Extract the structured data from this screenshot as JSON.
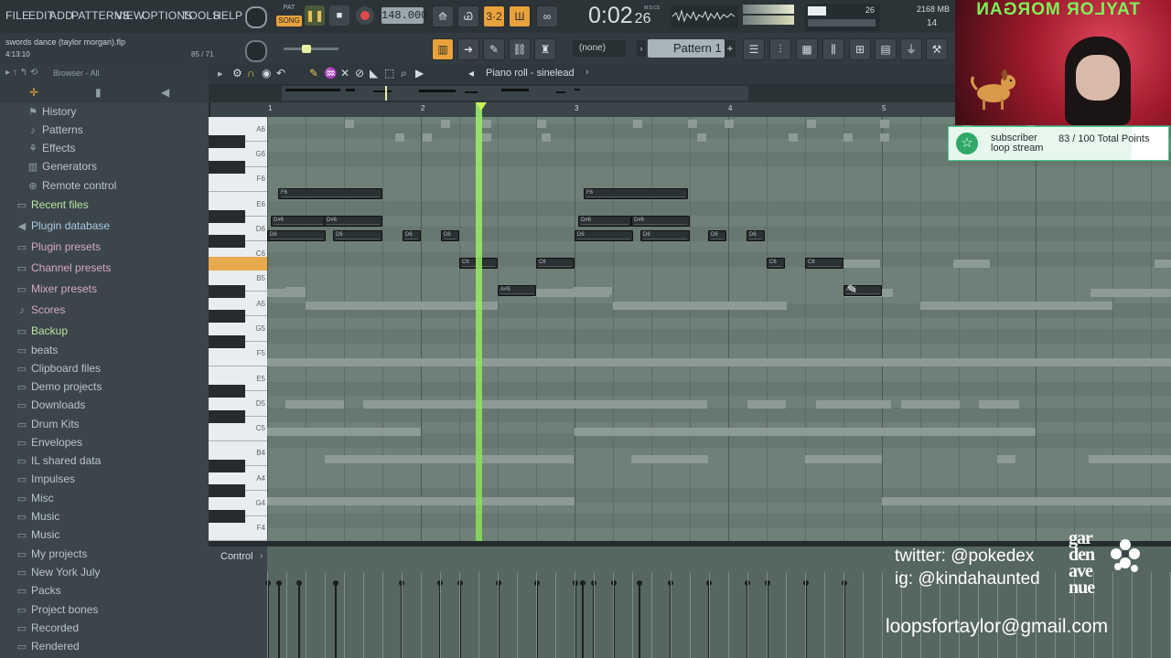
{
  "menu": [
    "FILE",
    "EDIT",
    "ADD",
    "PATTERNS",
    "VIEW",
    "OPTIONS",
    "TOOLS",
    "HELP"
  ],
  "transport": {
    "mode": "SONG",
    "pat_label": "PAT",
    "tempo": "148.000",
    "time": "0:02",
    "time_frac": "26",
    "time_unit": "M:S:CS",
    "cpu": "26",
    "memory": "2168 MB",
    "voices": "14",
    "pattern_name": "Pattern 1",
    "none_select": "(none)"
  },
  "project": {
    "filename": "swords dance (taylor morgan).flp",
    "position": "4:13:10",
    "counter": "85 / 71"
  },
  "browser": {
    "title": "Browser - All",
    "items": [
      {
        "label": "History",
        "icon": "history-icon",
        "color": "normal"
      },
      {
        "label": "Patterns",
        "icon": "note-icon",
        "color": "normal"
      },
      {
        "label": "Effects",
        "icon": "fx-icon",
        "color": "normal"
      },
      {
        "label": "Generators",
        "icon": "generator-icon",
        "color": "normal"
      },
      {
        "label": "Remote control",
        "icon": "remote-icon",
        "color": "normal"
      },
      {
        "label": "Recent files",
        "icon": "folder-icon",
        "color": "green"
      },
      {
        "label": "Plugin database",
        "icon": "plugin-icon",
        "color": "blue"
      },
      {
        "label": "Plugin presets",
        "icon": "folder-icon",
        "color": "pink"
      },
      {
        "label": "Channel presets",
        "icon": "folder-icon",
        "color": "pink"
      },
      {
        "label": "Mixer presets",
        "icon": "folder-icon",
        "color": "pink"
      },
      {
        "label": "Scores",
        "icon": "note-icon",
        "color": "pink"
      },
      {
        "label": "Backup",
        "icon": "folder-icon",
        "color": "green"
      },
      {
        "label": "beats",
        "icon": "folder-icon",
        "color": "normal"
      },
      {
        "label": "Clipboard files",
        "icon": "folder-icon",
        "color": "normal"
      },
      {
        "label": "Demo projects",
        "icon": "folder-icon",
        "color": "normal"
      },
      {
        "label": "Downloads",
        "icon": "folder-icon",
        "color": "normal"
      },
      {
        "label": "Drum Kits",
        "icon": "folder-icon",
        "color": "normal"
      },
      {
        "label": "Envelopes",
        "icon": "folder-icon",
        "color": "normal"
      },
      {
        "label": "IL shared data",
        "icon": "folder-icon",
        "color": "normal"
      },
      {
        "label": "Impulses",
        "icon": "folder-icon",
        "color": "normal"
      },
      {
        "label": "Misc",
        "icon": "folder-icon",
        "color": "normal"
      },
      {
        "label": "Music",
        "icon": "folder-icon",
        "color": "normal"
      },
      {
        "label": "Music",
        "icon": "folder-icon",
        "color": "normal"
      },
      {
        "label": "My projects",
        "icon": "folder-icon",
        "color": "normal"
      },
      {
        "label": "New York July",
        "icon": "folder-icon",
        "color": "normal"
      },
      {
        "label": "Packs",
        "icon": "folder-icon",
        "color": "normal"
      },
      {
        "label": "Project bones",
        "icon": "folder-icon",
        "color": "normal"
      },
      {
        "label": "Recorded",
        "icon": "folder-icon",
        "color": "normal"
      },
      {
        "label": "Rendered",
        "icon": "folder-icon",
        "color": "normal"
      }
    ]
  },
  "piano_roll": {
    "title": "Piano roll - sinelead",
    "ruler": [
      "1",
      "2",
      "3",
      "4",
      "5"
    ],
    "control_label": "Control",
    "key_labels": [
      "A6",
      "G6",
      "F6",
      "E6",
      "D6",
      "C6",
      "B5",
      "A5",
      "G5",
      "F5",
      "E5",
      "D5",
      "C5",
      "B4",
      "A4",
      "G4",
      "F4"
    ],
    "notes": [
      {
        "label": "F6"
      },
      {
        "label": "D#6"
      },
      {
        "label": "D#6"
      },
      {
        "label": "D6"
      },
      {
        "label": "D6"
      },
      {
        "label": "D6"
      },
      {
        "label": "D6"
      },
      {
        "label": "C6"
      },
      {
        "label": "A#5"
      },
      {
        "label": "C6"
      },
      {
        "label": "F6"
      },
      {
        "label": "D#6"
      },
      {
        "label": "D#6"
      },
      {
        "label": "D6"
      },
      {
        "label": "D6"
      },
      {
        "label": "D6"
      },
      {
        "label": "D6"
      },
      {
        "label": "C6"
      },
      {
        "label": "C6"
      },
      {
        "label": "A#5"
      }
    ]
  },
  "stream": {
    "banner": "TAYLOR MORGAN",
    "alert_line1": "subscriber",
    "alert_line2": "loop stream",
    "points": "83 / 100 Total Points",
    "twitter": "twitter: @pokedex",
    "instagram": "ig: @kindahaunted",
    "email": "loopsfortaylor@gmail.com",
    "logo_text": "gar den ave nue"
  },
  "colors": {
    "accent": "#e9a23b",
    "playhead": "#8ee85a",
    "grid": "#6f8078",
    "note": "#2b3033"
  }
}
